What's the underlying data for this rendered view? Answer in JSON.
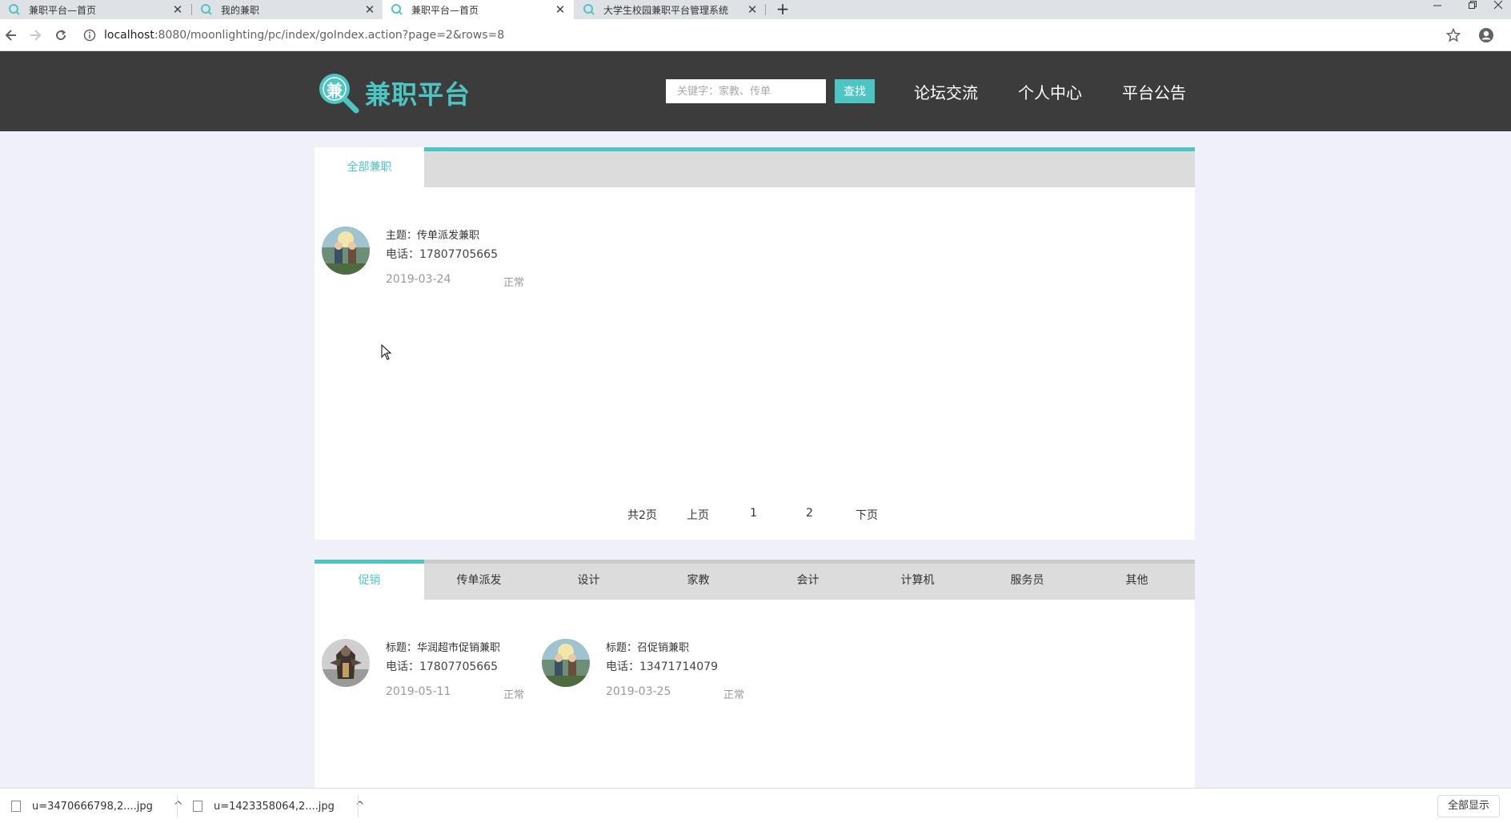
{
  "browser": {
    "tabs": [
      {
        "title": "兼职平台—首页",
        "active": false
      },
      {
        "title": "我的兼职",
        "active": false
      },
      {
        "title": "兼职平台—首页",
        "active": true
      },
      {
        "title": "大学生校园兼职平台管理系统",
        "active": false
      }
    ],
    "tab_close": "✕",
    "new_tab": "+",
    "url_host": "localhost",
    "url_path": ":8080/moonlighting/pc/index/goIndex.action?page=2&rows=8"
  },
  "header": {
    "logo_glyph": "兼",
    "logo_text": "兼职平台",
    "search_placeholder": "关键字：家教、传单",
    "search_button": "查找",
    "nav": [
      "论坛交流",
      "个人中心",
      "平台公告"
    ]
  },
  "all_jobs": {
    "tab_label": "全部兼职",
    "items": [
      {
        "title": "主题：传单派发兼职",
        "phone": "电话：17807705665",
        "date": "2019-03-24",
        "status": "正常",
        "avatar": "anime-pair"
      }
    ],
    "pager": {
      "total": "共2页",
      "prev": "上页",
      "pages": [
        "1",
        "2"
      ],
      "next": "下页"
    }
  },
  "category_jobs": {
    "tabs": [
      "促销",
      "传单派发",
      "设计",
      "家教",
      "会计",
      "计算机",
      "服务员",
      "其他"
    ],
    "active_tab": "促销",
    "items": [
      {
        "title": "标题：华润超市促销兼职",
        "phone": "电话：17807705665",
        "date": "2019-05-11",
        "status": "正常",
        "avatar": "armored-knight"
      },
      {
        "title": "标题：召促销兼职",
        "phone": "电话：13471714079",
        "date": "2019-03-25",
        "status": "正常",
        "avatar": "anime-pair"
      }
    ]
  },
  "downloads": {
    "items": [
      "u=3470666798,2....jpg",
      "u=1423358064,2....jpg"
    ],
    "caret": "^",
    "show_all": "全部显示"
  },
  "colors": {
    "accent": "#4dc6c3",
    "header_bg": "#3c3c3c",
    "page_bg": "#f0f0fa"
  }
}
